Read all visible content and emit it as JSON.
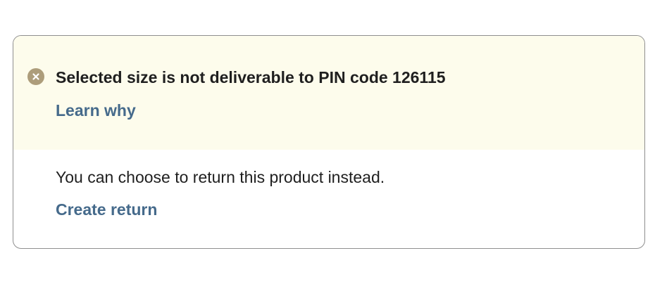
{
  "alert": {
    "icon": "close-circle-icon",
    "icon_color": "#ad9d7b",
    "background": "#fdfcec",
    "title": "Selected size is not deliverable to PIN code 126115",
    "link_label": "Learn why"
  },
  "body": {
    "message": "You can choose to return this product instead.",
    "link_label": "Create return"
  },
  "colors": {
    "link": "#456a8b",
    "text": "#1f1f1f",
    "border": "#8f8f8f"
  }
}
